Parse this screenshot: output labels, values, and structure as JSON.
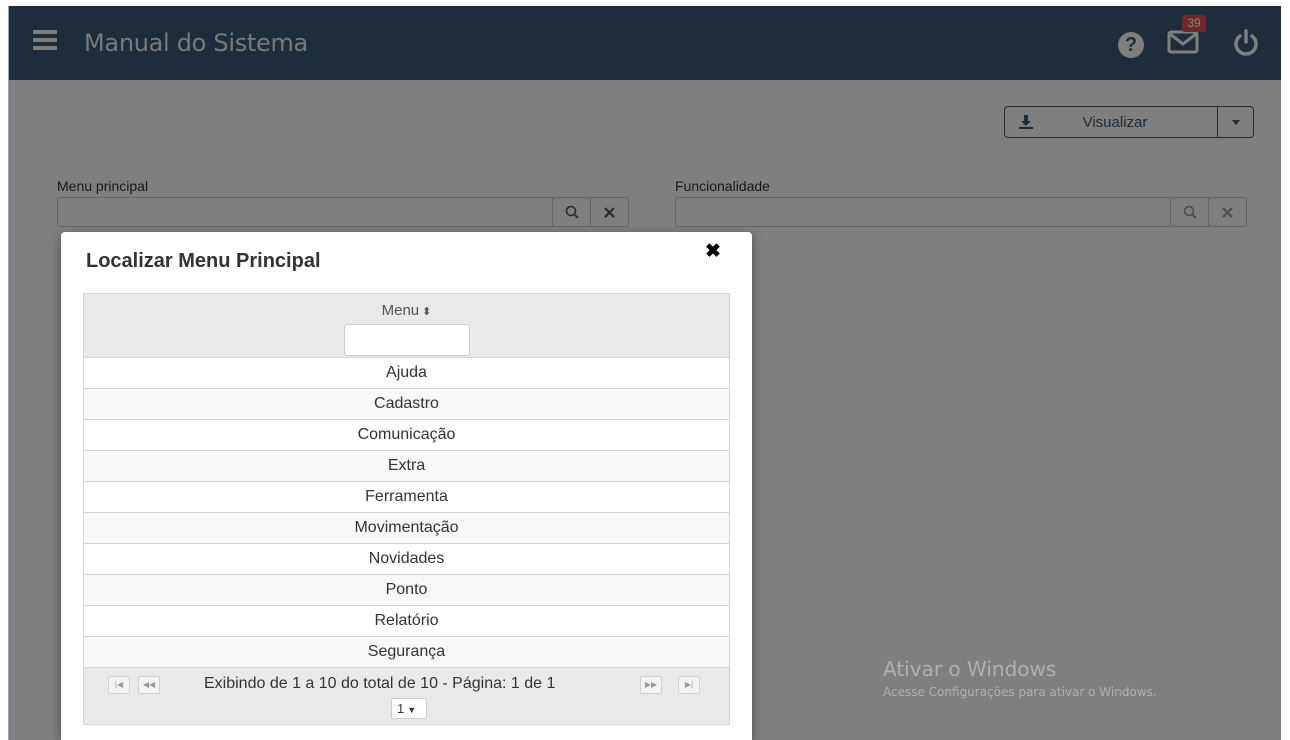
{
  "header": {
    "title": "Manual do Sistema",
    "help_glyph": "?",
    "messages_badge": "39"
  },
  "toolbar": {
    "visualizar_label": "Visualizar"
  },
  "form": {
    "menu_label": "Menu principal",
    "func_label": "Funcionalidade"
  },
  "modal": {
    "title": "Localizar Menu Principal",
    "column_header": "Menu",
    "rows": [
      "Ajuda",
      "Cadastro",
      "Comunicação",
      "Extra",
      "Ferramenta",
      "Movimentação",
      "Novidades",
      "Ponto",
      "Relatório",
      "Segurança"
    ],
    "pager_info": "Exibindo de 1 a 10 do total de 10 - Página: 1 de 1",
    "page_size": "1"
  },
  "watermark": {
    "title": "Ativar o Windows",
    "subtitle": "Acesse Configurações para ativar o Windows."
  },
  "colors": {
    "header_bg": "#3c5a78",
    "badge": "#d9534f"
  },
  "icons": [
    "hamburger-icon",
    "help-icon",
    "mail-icon",
    "power-icon",
    "download-icon",
    "search-icon",
    "clear-icon",
    "close-icon",
    "sort-icon",
    "first-page-icon",
    "prev-page-icon",
    "next-page-icon",
    "last-page-icon",
    "chevron-down-icon"
  ]
}
